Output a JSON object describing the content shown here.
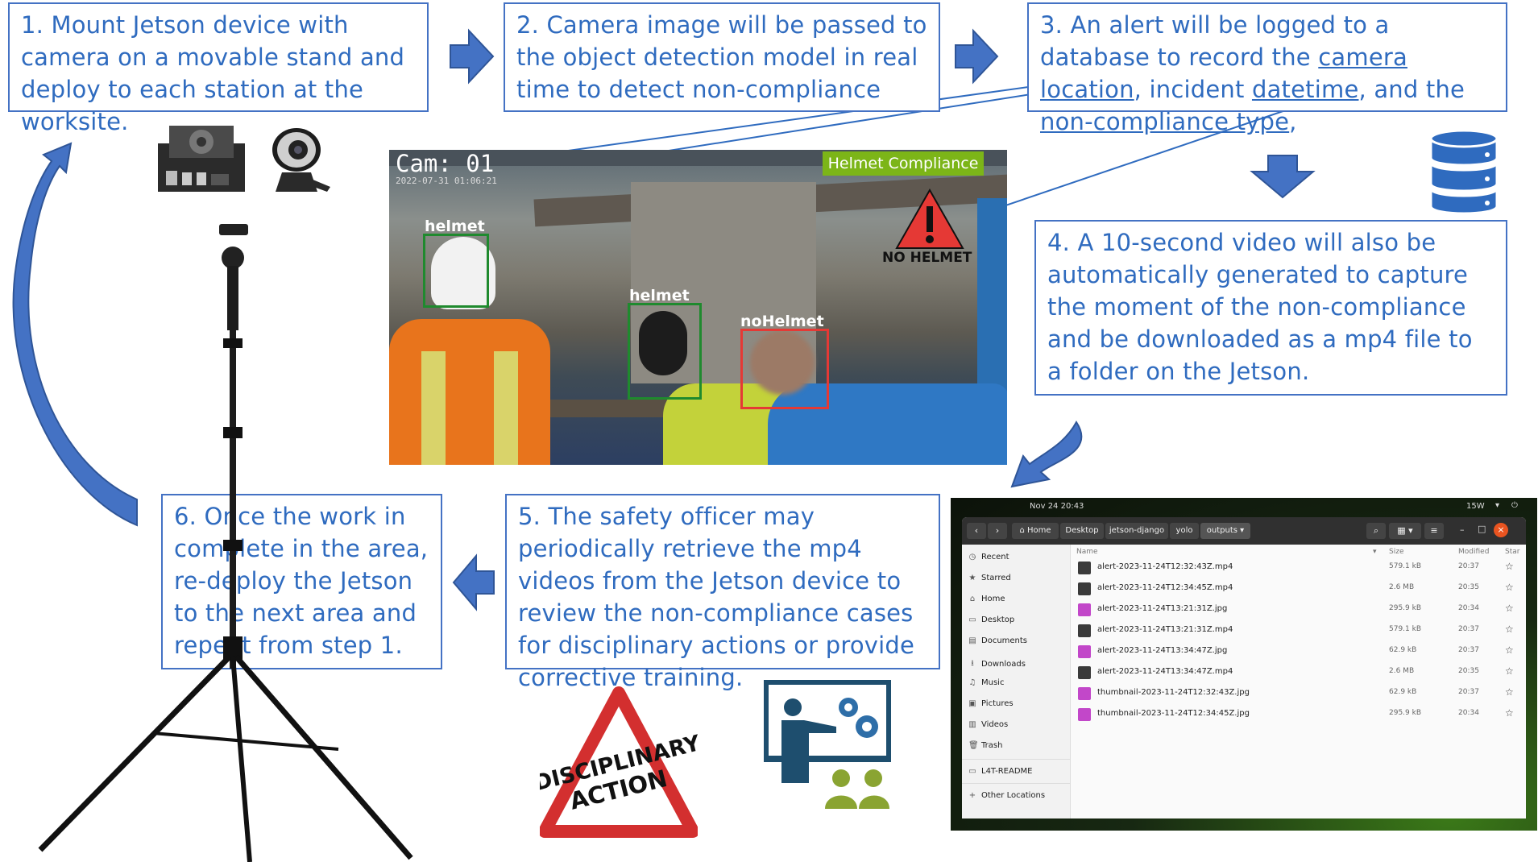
{
  "steps": {
    "s1": "1. Mount Jetson device with camera on a movable stand and deploy to each station at the worksite.",
    "s2": "2. Camera image will be passed to the object detection model in real time to detect non-compliance",
    "s3_a": "3. An alert will be logged to a database to record the ",
    "s3_link1": "camera location",
    "s3_b": ", incident ",
    "s3_link2": "datetime",
    "s3_c": ", and the ",
    "s3_link3": "non-compliance type",
    "s3_d": ",",
    "s4": "4. A 10-second video will also be automatically generated to capture the moment of the non-compliance and be downloaded as a mp4 file to a folder on the Jetson.",
    "s5": "5. The safety officer may periodically retrieve the mp4 videos from the Jetson device to review the non-compliance cases for disciplinary actions or provide corrective training.",
    "s6": "6. Once the work in complete in the area, re-deploy the Jetson to the next area and repeat from step 1."
  },
  "camera": {
    "cam_id": "Cam: 01",
    "timestamp": "2022-07-31 01:06:21",
    "banner": "Helmet Compliance",
    "alert_text": "NO HELMET",
    "detections": [
      {
        "label": "helmet",
        "color": "#1f8a2e"
      },
      {
        "label": "helmet",
        "color": "#1f8a2e"
      },
      {
        "label": "noHelmet",
        "color": "#e53935"
      }
    ]
  },
  "disciplinary": {
    "line1": "DISCIPLINARY",
    "line2": "ACTION"
  },
  "file_manager": {
    "clock": "Nov 24  20:43",
    "tray": "15W",
    "breadcrumbs": [
      "Home",
      "Desktop",
      "jetson-django",
      "yolo",
      "outputs"
    ],
    "columns": {
      "name": "Name",
      "size": "Size",
      "modified": "Modified",
      "star": "Star"
    },
    "sidebar": [
      {
        "icon": "clock-icon",
        "label": "Recent"
      },
      {
        "icon": "star-icon",
        "label": "Starred"
      },
      {
        "icon": "home-icon",
        "label": "Home"
      },
      {
        "icon": "desktop-icon",
        "label": "Desktop"
      },
      {
        "icon": "document-icon",
        "label": "Documents"
      },
      {
        "icon": "download-icon",
        "label": "Downloads"
      },
      {
        "icon": "music-icon",
        "label": "Music"
      },
      {
        "icon": "picture-icon",
        "label": "Pictures"
      },
      {
        "icon": "video-icon",
        "label": "Videos"
      },
      {
        "icon": "trash-icon",
        "label": "Trash"
      },
      {
        "icon": "drive-icon",
        "label": "L4T-README"
      },
      {
        "icon": "plus-icon",
        "label": "Other Locations"
      }
    ],
    "files": [
      {
        "name": "alert-2023-11-24T12:32:43Z.mp4",
        "size": "579.1 kB",
        "modified": "20:37",
        "kind": "video"
      },
      {
        "name": "alert-2023-11-24T12:34:45Z.mp4",
        "size": "2.6 MB",
        "modified": "20:35",
        "kind": "video"
      },
      {
        "name": "alert-2023-11-24T13:21:31Z.jpg",
        "size": "295.9 kB",
        "modified": "20:34",
        "kind": "image"
      },
      {
        "name": "alert-2023-11-24T13:21:31Z.mp4",
        "size": "579.1 kB",
        "modified": "20:37",
        "kind": "video"
      },
      {
        "name": "alert-2023-11-24T13:34:47Z.jpg",
        "size": "62.9 kB",
        "modified": "20:37",
        "kind": "image"
      },
      {
        "name": "alert-2023-11-24T13:34:47Z.mp4",
        "size": "2.6 MB",
        "modified": "20:35",
        "kind": "video"
      },
      {
        "name": "thumbnail-2023-11-24T12:32:43Z.jpg",
        "size": "62.9 kB",
        "modified": "20:37",
        "kind": "image"
      },
      {
        "name": "thumbnail-2023-11-24T12:34:45Z.jpg",
        "size": "295.9 kB",
        "modified": "20:34",
        "kind": "image"
      }
    ]
  },
  "colors": {
    "accent": "#4472c4",
    "text_blue": "#2f6bbf",
    "video_icon": "#3a3a3a",
    "image_icon": "#c247c9"
  }
}
